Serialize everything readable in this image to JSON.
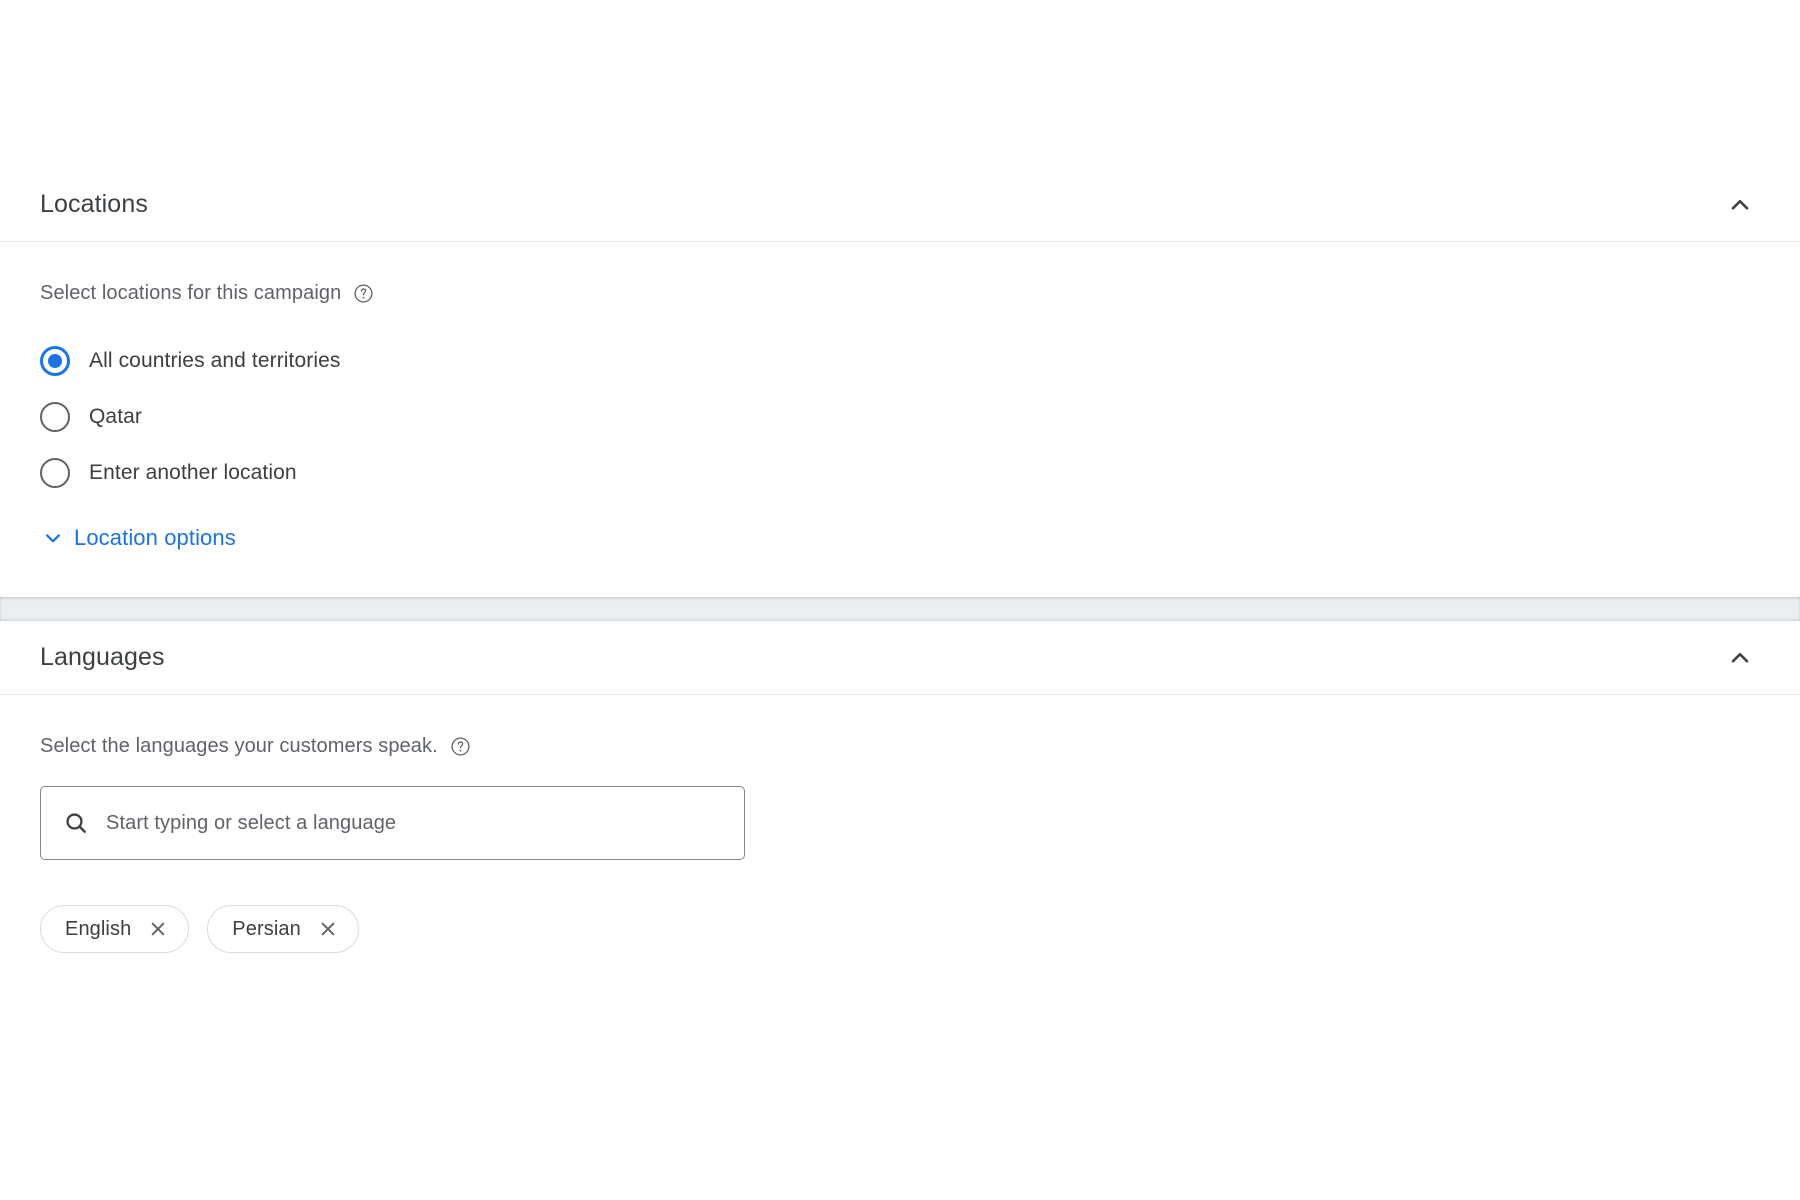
{
  "theme": {
    "accent_blue": "#1a73e8",
    "text_primary": "#3c4043",
    "text_secondary": "#5f6368",
    "border": "#dadce0",
    "gap_gray": "#eceff1"
  },
  "locations_section": {
    "title": "Locations",
    "collapse_icon": "chevron-up-icon",
    "description": "Select locations for this campaign",
    "help_icon": "help-circle-icon",
    "radio_options": [
      {
        "label": "All countries and territories",
        "selected": true
      },
      {
        "label": "Qatar",
        "selected": false
      },
      {
        "label": "Enter another location",
        "selected": false
      }
    ],
    "options_link": {
      "label": "Location options",
      "icon": "chevron-down-icon"
    }
  },
  "languages_section": {
    "title": "Languages",
    "collapse_icon": "chevron-up-icon",
    "description": "Select the languages your customers speak.",
    "help_icon": "help-circle-icon",
    "search": {
      "icon": "search-icon",
      "value": "",
      "placeholder": "Start typing or select a language"
    },
    "selected_languages": [
      {
        "label": "English",
        "remove_icon": "close-icon"
      },
      {
        "label": "Persian",
        "remove_icon": "close-icon"
      }
    ]
  }
}
